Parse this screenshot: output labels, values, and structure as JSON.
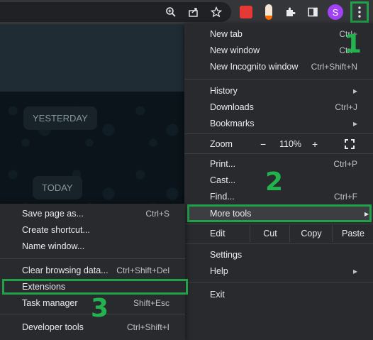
{
  "menu": {
    "new_tab": {
      "label": "New tab",
      "shortcut": "Ctrl+"
    },
    "new_window": {
      "label": "New window",
      "shortcut": "Ctrl+"
    },
    "new_incognito": {
      "label": "New Incognito window",
      "shortcut": "Ctrl+Shift+N"
    },
    "history": {
      "label": "History",
      "shortcut": ""
    },
    "downloads": {
      "label": "Downloads",
      "shortcut": "Ctrl+J"
    },
    "bookmarks": {
      "label": "Bookmarks",
      "shortcut": ""
    },
    "zoom": {
      "label": "Zoom",
      "minus": "−",
      "level": "110%",
      "plus": "+"
    },
    "print": {
      "label": "Print...",
      "shortcut": "Ctrl+P"
    },
    "cast": {
      "label": "Cast..."
    },
    "find": {
      "label": "Find...",
      "shortcut": "Ctrl+F"
    },
    "more_tools": {
      "label": "More tools"
    },
    "edit": {
      "label": "Edit",
      "cut": "Cut",
      "copy": "Copy",
      "paste": "Paste"
    },
    "settings": {
      "label": "Settings"
    },
    "help": {
      "label": "Help"
    },
    "exit": {
      "label": "Exit"
    }
  },
  "submenu": {
    "save_page": {
      "label": "Save page as...",
      "shortcut": "Ctrl+S"
    },
    "create_shortcut": {
      "label": "Create shortcut..."
    },
    "name_window": {
      "label": "Name window..."
    },
    "clear_data": {
      "label": "Clear browsing data...",
      "shortcut": "Ctrl+Shift+Del"
    },
    "extensions": {
      "label": "Extensions"
    },
    "task_manager": {
      "label": "Task manager",
      "shortcut": "Shift+Esc"
    },
    "developer_tools": {
      "label": "Developer tools",
      "shortcut": "Ctrl+Shift+I"
    }
  },
  "toolbar": {
    "avatar_letter": "S"
  },
  "chat": {
    "yesterday": "YESTERDAY",
    "today": "TODAY"
  },
  "steps": {
    "one": "1",
    "two": "2",
    "three": "3"
  },
  "colors": {
    "highlight": "#22a04a",
    "menu_bg": "#292a2d"
  }
}
